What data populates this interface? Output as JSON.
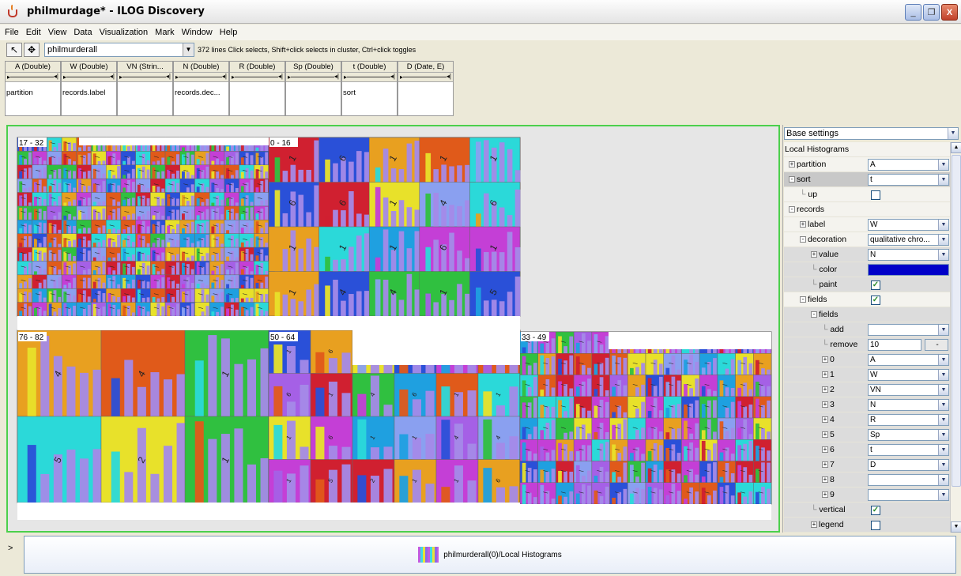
{
  "window": {
    "title": "philmurdage* - ILOG Discovery",
    "min": "_",
    "max": "❐",
    "close": "X"
  },
  "menu": [
    "File",
    "Edit",
    "View",
    "Data",
    "Visualization",
    "Mark",
    "Window",
    "Help"
  ],
  "toolbar": {
    "dataset": "philmurderall",
    "status": "372 lines  Click selects, Shift+click selects in cluster, Ctrl+click toggles"
  },
  "columns": [
    {
      "head": "A (Double)",
      "tag": "partition"
    },
    {
      "head": "W (Double)",
      "tag": "records.label"
    },
    {
      "head": "VN (Strin...",
      "tag": ""
    },
    {
      "head": "N (Double)",
      "tag": "records.dec..."
    },
    {
      "head": "R (Double)",
      "tag": ""
    },
    {
      "head": "Sp (Double)",
      "tag": ""
    },
    {
      "head": "t (Double)",
      "tag": "sort"
    },
    {
      "head": "D (Date, E)",
      "tag": ""
    }
  ],
  "viz": {
    "groups": [
      {
        "label": "17 - 32"
      },
      {
        "label": "0 - 16"
      },
      {
        "label": "76 - 82"
      },
      {
        "label": "50 - 64"
      },
      {
        "label": "33 - 49"
      }
    ],
    "big_labels": [
      "1",
      "6",
      "1",
      "1",
      "1",
      "6",
      "6",
      "1",
      "4",
      "6",
      "1",
      "1",
      "1",
      "6",
      "1",
      "1",
      "4",
      "4",
      "1",
      "5",
      "2",
      "1"
    ]
  },
  "props": {
    "base": "Base settings",
    "section": "Local Histograms",
    "rows": [
      {
        "label": "partition",
        "value": "A",
        "kind": "combo",
        "indent": 0,
        "exp": "+"
      },
      {
        "label": "sort",
        "value": "t",
        "kind": "combo",
        "indent": 0,
        "exp": "-",
        "sel": true
      },
      {
        "label": "up",
        "kind": "check",
        "checked": false,
        "indent": 1
      },
      {
        "label": "records",
        "kind": "none",
        "indent": 0,
        "exp": "-"
      },
      {
        "label": "label",
        "value": "W",
        "kind": "combo",
        "indent": 1,
        "exp": "+"
      },
      {
        "label": "decoration",
        "value": "qualitative chro...",
        "kind": "combo",
        "indent": 1,
        "exp": "-"
      },
      {
        "label": "value",
        "value": "N",
        "kind": "combo",
        "indent": 2,
        "exp": "+"
      },
      {
        "label": "color",
        "kind": "color",
        "indent": 2
      },
      {
        "label": "paint",
        "kind": "check",
        "checked": true,
        "indent": 2
      },
      {
        "label": "fields",
        "kind": "check",
        "checked": true,
        "indent": 1,
        "exp": "-"
      },
      {
        "label": "fields",
        "kind": "none",
        "indent": 2,
        "exp": "-"
      },
      {
        "label": "add",
        "value": "",
        "kind": "combo",
        "indent": 3
      },
      {
        "label": "remove",
        "value": "10",
        "kind": "spin",
        "indent": 3
      },
      {
        "label": "0",
        "value": "A",
        "kind": "combo",
        "indent": 3,
        "exp": "+"
      },
      {
        "label": "1",
        "value": "W",
        "kind": "combo",
        "indent": 3,
        "exp": "+"
      },
      {
        "label": "2",
        "value": "VN",
        "kind": "combo",
        "indent": 3,
        "exp": "+"
      },
      {
        "label": "3",
        "value": "N",
        "kind": "combo",
        "indent": 3,
        "exp": "+"
      },
      {
        "label": "4",
        "value": "R",
        "kind": "combo",
        "indent": 3,
        "exp": "+"
      },
      {
        "label": "5",
        "value": "Sp",
        "kind": "combo",
        "indent": 3,
        "exp": "+"
      },
      {
        "label": "6",
        "value": "t",
        "kind": "combo",
        "indent": 3,
        "exp": "+"
      },
      {
        "label": "7",
        "value": "D",
        "kind": "combo",
        "indent": 3,
        "exp": "+"
      },
      {
        "label": "8",
        "value": "",
        "kind": "combo",
        "indent": 3,
        "exp": "+"
      },
      {
        "label": "9",
        "value": "",
        "kind": "combo",
        "indent": 3,
        "exp": "+"
      },
      {
        "label": "vertical",
        "kind": "check",
        "checked": true,
        "indent": 2
      },
      {
        "label": "legend",
        "kind": "check",
        "checked": false,
        "indent": 2,
        "exp": "+"
      }
    ]
  },
  "bottom": {
    "label": "philmurderall(0)/Local Histograms"
  },
  "colors": {
    "palette": [
      "#c43fd6",
      "#e05a1a",
      "#e8e12a",
      "#2bd9d9",
      "#30c040",
      "#2a50d8",
      "#a560e6",
      "#e8a020",
      "#1fa0e0",
      "#d02030",
      "#8aa0f0"
    ]
  }
}
